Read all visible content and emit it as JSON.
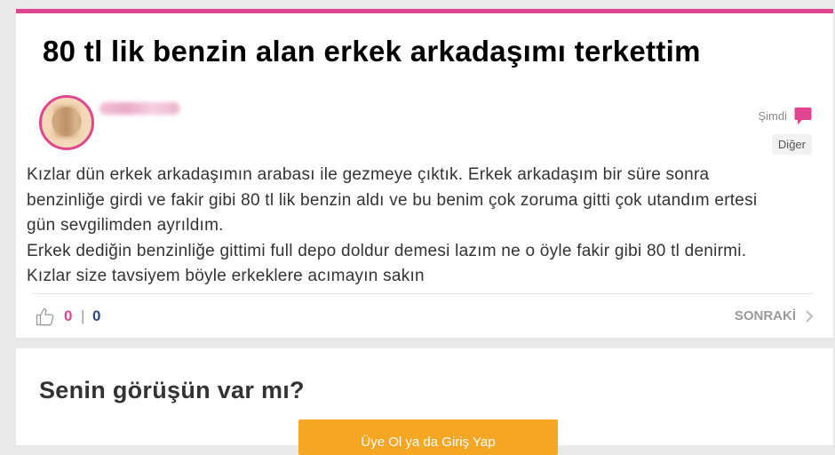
{
  "post": {
    "title": "80 tl lik benzin alan erkek arkadaşımı terkettim",
    "time": "Şimdi",
    "category": "Diğer",
    "body": [
      "Kızlar dün erkek arkadaşımın arabası ile gezmeye çıktık. Erkek arkadaşım bir süre sonra benzinliğe girdi ve fakir gibi 80 tl lik benzin aldı ve bu benim çok zoruma gitti çok utandım ertesi gün sevgilimden ayrıldım.",
      "Erkek dediğin benzinliğe gittimi full depo doldur demesi lazım ne o öyle fakir gibi 80 tl denirmi. Kızlar size tavsiyem böyle erkeklere acımayın sakın"
    ],
    "likes": "0",
    "separator": "|",
    "dislikes": "0",
    "next_label": "SONRAKİ"
  },
  "opinion": {
    "heading": "Senin görüşün var mı?",
    "button_label": "Üye Ol ya da Giriş Yap"
  },
  "icons": {
    "comment": "speech-bubble-icon",
    "like": "thumbs-up-icon",
    "next": "chevron-right-icon"
  },
  "colors": {
    "accent": "#e0468f",
    "dislike": "#2e4a7d",
    "button": "#f5a623",
    "background": "#e9e9e9"
  }
}
